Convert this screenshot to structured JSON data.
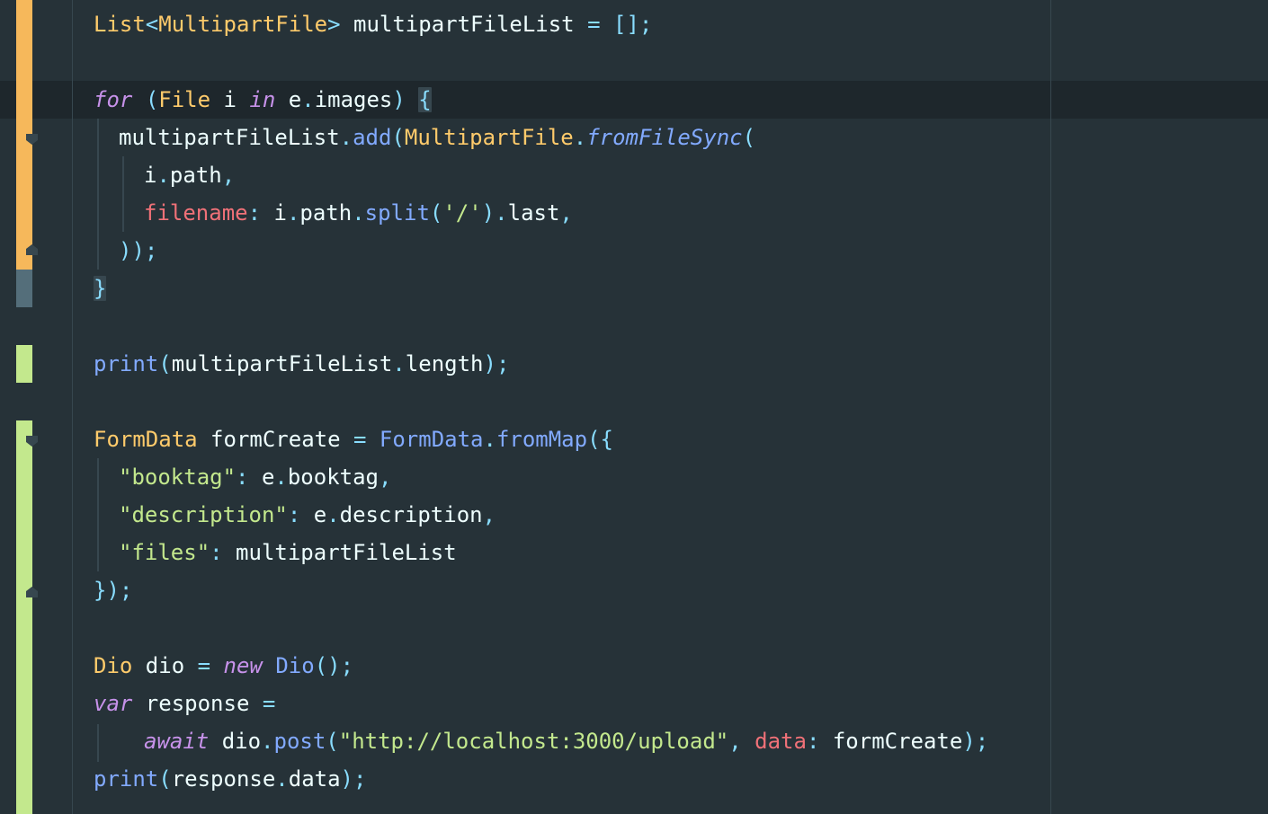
{
  "colors": {
    "background": "#263238",
    "current_line": "#1e272c",
    "keyword": "#c792ea",
    "type": "#ffcb6b",
    "function": "#82aaff",
    "punctuation": "#89ddff",
    "identifier": "#eeffff",
    "string": "#c3e88d",
    "named_parameter": "#f07178",
    "change_modified": "#f6b85b",
    "change_added": "#c3e88d",
    "change_deleted": "#546e7a"
  },
  "code": {
    "line1": {
      "t1": "List",
      "t2": "<",
      "t3": "MultipartFile",
      "t4": ">",
      "t5": " multipartFileList ",
      "t6": "=",
      "t7": " ",
      "t8": "[];"
    },
    "line2": {
      "t1": "for",
      "t2": " ",
      "t3": "(",
      "t4": "File",
      "t5": " i ",
      "t6": "in",
      "t7": " e",
      "t8": ".",
      "t9": "images",
      "t10": ")",
      "t11": " ",
      "t12": "{"
    },
    "line3": {
      "t1": "multipartFileList",
      "t2": ".",
      "t3": "add",
      "t4": "(",
      "t5": "MultipartFile",
      "t6": ".",
      "t7": "fromFileSync",
      "t8": "("
    },
    "line4": {
      "t1": "i",
      "t2": ".",
      "t3": "path",
      "t4": ","
    },
    "line5": {
      "t1": "filename",
      "t2": ":",
      "t3": " i",
      "t4": ".",
      "t5": "path",
      "t6": ".",
      "t7": "split",
      "t8": "(",
      "t9": "'/'",
      "t10": ")",
      "t11": ".",
      "t12": "last",
      "t13": ","
    },
    "line6": {
      "t1": "));"
    },
    "line7": {
      "t1": "}"
    },
    "line8": {
      "t1": "print",
      "t2": "(",
      "t3": "multipartFileList",
      "t4": ".",
      "t5": "length",
      "t6": ");"
    },
    "line9": {
      "t1": "FormData",
      "t2": " formCreate ",
      "t3": "=",
      "t4": " ",
      "t5": "FormData",
      "t6": ".",
      "t7": "fromMap",
      "t8": "({"
    },
    "line10": {
      "t1": "\"booktag\"",
      "t2": ":",
      "t3": " e",
      "t4": ".",
      "t5": "booktag",
      "t6": ","
    },
    "line11": {
      "t1": "\"description\"",
      "t2": ":",
      "t3": " e",
      "t4": ".",
      "t5": "description",
      "t6": ","
    },
    "line12": {
      "t1": "\"files\"",
      "t2": ":",
      "t3": " multipartFileList"
    },
    "line13": {
      "t1": "});"
    },
    "line14": {
      "t1": "Dio",
      "t2": " dio ",
      "t3": "=",
      "t4": " ",
      "t5": "new",
      "t6": " ",
      "t7": "Dio",
      "t8": "();"
    },
    "line15": {
      "t1": "var",
      "t2": " response ",
      "t3": "="
    },
    "line16": {
      "t1": "await",
      "t2": " dio",
      "t3": ".",
      "t4": "post",
      "t5": "(",
      "t6": "\"http://localhost:3000/upload\"",
      "t7": ",",
      "t8": " ",
      "t9": "data",
      "t10": ":",
      "t11": " formCreate",
      "t12": ");"
    },
    "line17": {
      "t1": "print",
      "t2": "(",
      "t3": "response",
      "t4": ".",
      "t5": "data",
      "t6": ");"
    }
  }
}
